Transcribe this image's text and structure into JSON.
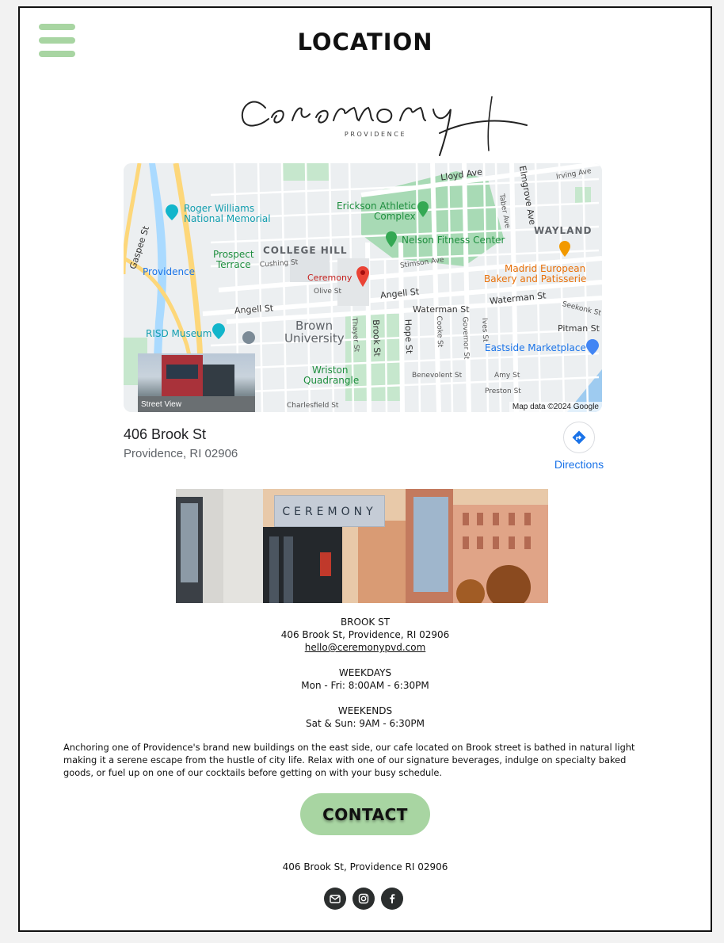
{
  "header": {
    "title": "LOCATION",
    "menu_icon": "hamburger-menu-icon"
  },
  "logo": {
    "script_text": "ceremony",
    "subtitle": "PROVIDENCE"
  },
  "map": {
    "labels": {
      "roger_williams": "Roger Williams",
      "national_memorial": "National Memorial",
      "erickson_1": "Erickson Athletic",
      "erickson_2": "Complex",
      "nelson": "Nelson Fitness Center",
      "wayland": "WAYLAND",
      "college_hill": "COLLEGE HILL",
      "prospect_1": "Prospect",
      "prospect_2": "Terrace",
      "providence": "Providence",
      "ceremony": "Ceremony",
      "madrid_1": "Madrid European",
      "madrid_2": "Bakery and Patisserie",
      "risd": "RISD Museum",
      "brown_1": "Brown",
      "brown_2": "University",
      "eastside": "Eastside Marketplace",
      "wriston_1": "Wriston",
      "wriston_2": "Quadrangle",
      "lloyd": "Lloyd Ave",
      "irving": "Irving Ave",
      "elmgrove": "Elmgrove Ave",
      "taber": "Taber Ave",
      "gaspee": "Gaspee St",
      "cushing": "Cushing St",
      "stimson": "Stimson Ave",
      "olive": "Olive St",
      "angell_left": "Angell St",
      "angell_right": "Angell St",
      "waterman_1": "Waterman St",
      "waterman_2": "Waterman St",
      "seekonk": "Seekonk St",
      "pitman": "Pitman St",
      "thayer": "Thayer St",
      "brook": "Brook St",
      "hope": "Hope St",
      "cooke": "Cooke St",
      "governor": "Governor St",
      "ives": "Ives St",
      "benevolent": "Benevolent St",
      "amy": "Amy St",
      "preston": "Preston St",
      "charlesfield": "Charlesfield St"
    },
    "street_view_label": "Street View",
    "attribution": "Map data ©2024 Google"
  },
  "place_card": {
    "name": "406 Brook St",
    "city": "Providence, RI 02906",
    "directions_label": "Directions",
    "directions_icon": "directions-icon"
  },
  "photo": {
    "sign_text": "CEREMONY"
  },
  "info": {
    "location_name": "BROOK ST",
    "address": "406 Brook St, Providence, RI 02906",
    "email": "hello@ceremonypvd.com",
    "weekdays_heading": "WEEKDAYS",
    "weekdays_hours": "Mon - Fri: 8:00AM - 6:30PM",
    "weekends_heading": "WEEKENDS",
    "weekends_hours": "Sat & Sun: 9AM - 6:30PM"
  },
  "about": "Anchoring one of Providence's brand new buildings on the east side, our cafe located on Brook street is bathed in natural light making it a serene escape from the hustle of city life. Relax with one of our signature beverages, indulge on  specialty baked goods, or fuel up on one of our cocktails before getting on with your busy schedule.",
  "contact_button": "CONTACT",
  "footer": {
    "address": "406 Brook St, Providence RI 02906",
    "social": [
      "email-icon",
      "instagram-icon",
      "facebook-icon"
    ]
  },
  "colors": {
    "accent_green": "#a8d5a2",
    "link_blue": "#1a73e8",
    "social_bg": "#2b2e2e"
  }
}
